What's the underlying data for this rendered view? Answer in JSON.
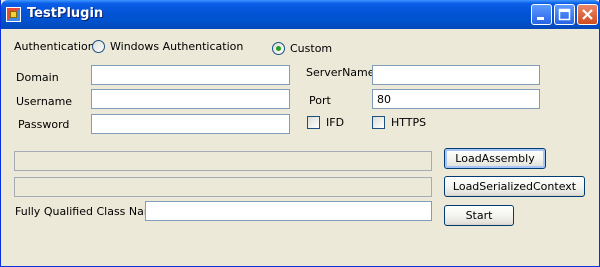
{
  "window": {
    "title": "TestPlugin"
  },
  "auth": {
    "label": "Authentication",
    "options": [
      {
        "label": "Windows Authentication",
        "selected": false
      },
      {
        "label": "Custom",
        "selected": true
      }
    ]
  },
  "fields": {
    "domain": {
      "label": "Domain",
      "value": ""
    },
    "username": {
      "label": "Username",
      "value": ""
    },
    "password": {
      "label": "Password",
      "value": ""
    },
    "servername": {
      "label": "ServerName",
      "value": ""
    },
    "port": {
      "label": "Port",
      "value": "80"
    }
  },
  "checkboxes": {
    "ifd": {
      "label": "IFD",
      "checked": false
    },
    "https": {
      "label": "HTTPS",
      "checked": false
    }
  },
  "assembly_path": {
    "value": ""
  },
  "context_path": {
    "value": ""
  },
  "class_name": {
    "label": "Fully Qualified Class Name",
    "value": ""
  },
  "buttons": {
    "load_assembly": "LoadAssembly",
    "load_context": "LoadSerializedContext",
    "start": "Start"
  },
  "colors": {
    "titlebar": "#0053ce",
    "window_bg": "#ece9d8",
    "radio_dot": "#21a121",
    "close_button": "#cf4b1f"
  }
}
